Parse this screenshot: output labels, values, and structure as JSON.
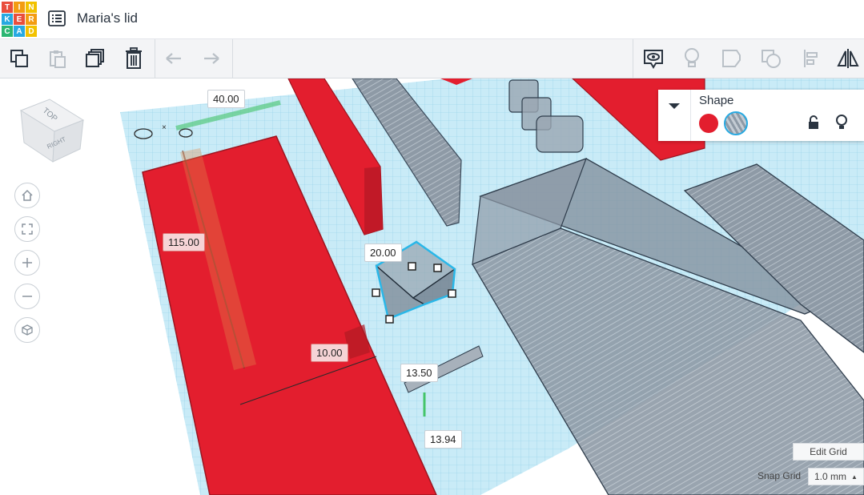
{
  "logo": {
    "letters": [
      "T",
      "I",
      "N",
      "K",
      "E",
      "R",
      "C",
      "A",
      "D"
    ],
    "colors": [
      "#e94e3c",
      "#f39c12",
      "#f2c200",
      "#27a9e1",
      "#e94e3c",
      "#f39c12",
      "#2bb673",
      "#27a9e1",
      "#f2c200"
    ]
  },
  "header": {
    "title": "Maria's lid",
    "menu_icon": "list-icon"
  },
  "toolbar": {
    "icons": [
      "copy-icon",
      "paste-icon",
      "duplicate-icon",
      "delete-icon",
      "undo-icon",
      "redo-icon",
      "show-all-icon",
      "notes-icon",
      "group-icon",
      "ungroup-icon",
      "align-icon",
      "mirror-icon"
    ]
  },
  "view_cube": {
    "top_label": "TOP",
    "right_label": "RIGHT"
  },
  "nav_icons": [
    "home-icon",
    "fit-icon",
    "zoom-in-icon",
    "zoom-out-icon",
    "perspective-icon"
  ],
  "dimensions": {
    "width": "40.00",
    "length": "115.00",
    "height": "20.00",
    "elevation": "10.00",
    "dim_a": "13.50",
    "dim_b": "13.94"
  },
  "shape_panel": {
    "title": "Shape",
    "solid_color": "#e31e2e",
    "hole_label_icon": "hole-swatch",
    "lock_icon": "lock-icon",
    "light_icon": "bulb-icon"
  },
  "grid": {
    "edit_label": "Edit Grid",
    "snap_label": "Snap Grid",
    "snap_value": "1.0 mm"
  },
  "colors": {
    "accent": "#e31e2e",
    "plane": "#bfe6f5",
    "hole": "#8e9aa6"
  }
}
